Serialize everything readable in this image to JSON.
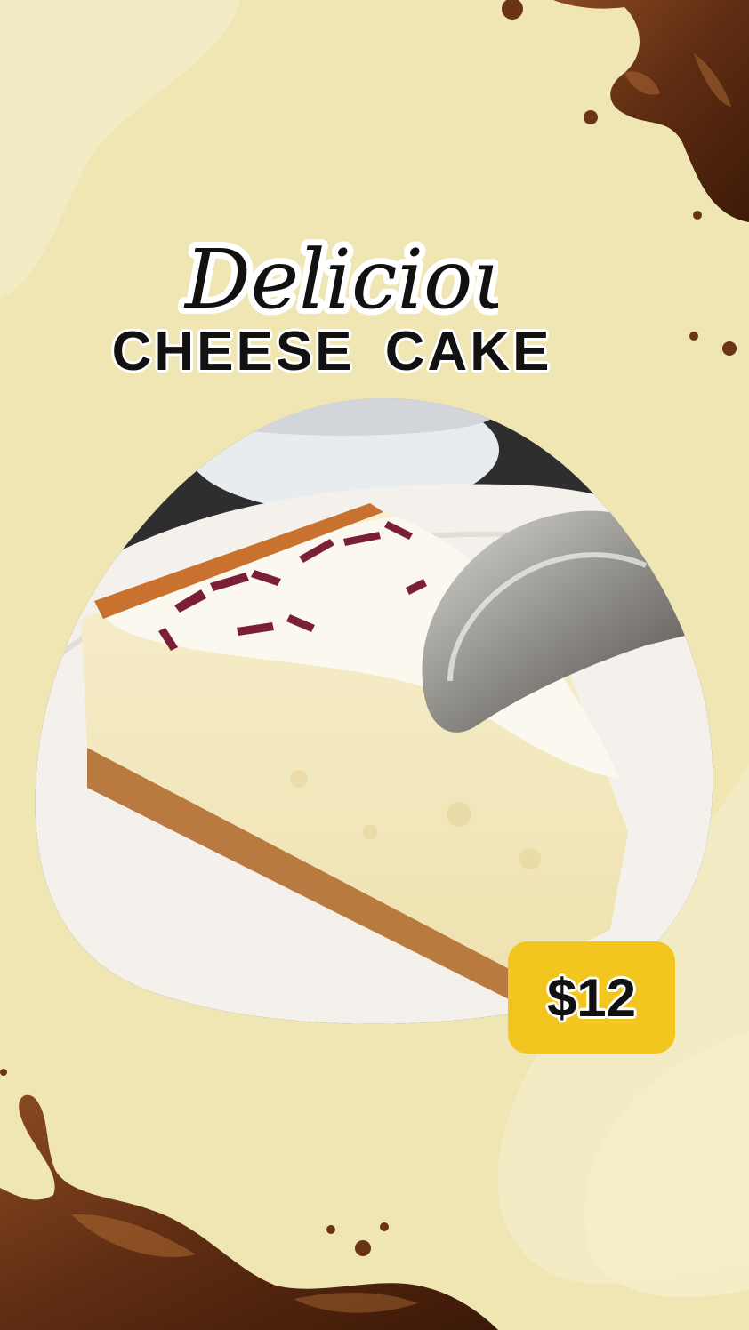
{
  "poster": {
    "script_title": "Delicious",
    "main_title": "CHEESE  CAKE",
    "price": "$12"
  },
  "colors": {
    "background": "#efe6b4",
    "badge": "#f2c61f",
    "chocolate": "#6b3415"
  },
  "icons": [
    "chocolate-splash-top-right",
    "chocolate-splash-bottom-left",
    "cheesecake-photo"
  ]
}
